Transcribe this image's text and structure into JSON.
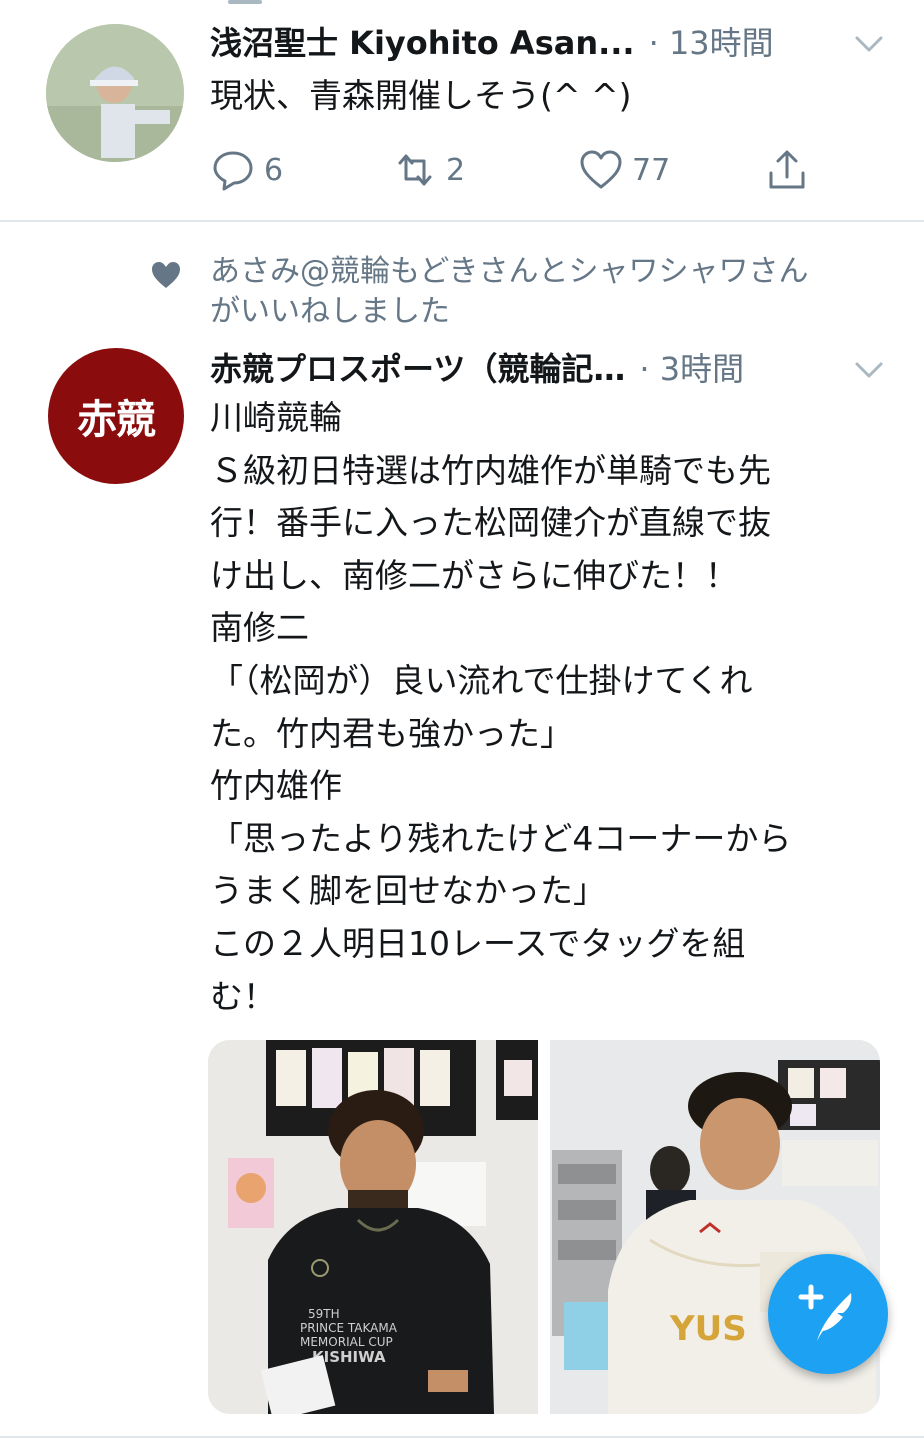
{
  "tweet1": {
    "author": "浅沼聖士 Kiyohito Asan...",
    "time": "· 13時間",
    "text": "現状、青森開催しそう(^ ^)",
    "replies": "6",
    "retweets": "2",
    "likes": "77"
  },
  "social_context": {
    "lines": [
      "あさみ@競輪もどきさんとシャワシャワさん",
      "がいいねしました"
    ]
  },
  "tweet2": {
    "avatar_text": "赤競",
    "author": "赤競プロスポーツ（競輪記…",
    "time": "· 3時間",
    "lines": [
      "川崎競輪",
      "Ｓ級初日特選は竹内雄作が単騎でも先",
      "行！番手に入った松岡健介が直線で抜",
      "け出し、南修二がさらに伸びた！！",
      "南修二",
      "「（松岡が）良い流れで仕掛けてくれ",
      "た。竹内君も強かった」",
      "竹内雄作",
      "「思ったより残れたけど4コーナーから",
      "うまく脚を回せなかった」",
      "この２人明日10レースでタッグを組",
      "む！"
    ],
    "photos": {
      "left": {
        "jersey_text": [
          "59TH",
          "PRINCE TAKAMA",
          "MEMORIAL CUP",
          "KISHIWA"
        ]
      },
      "right": {
        "jersey_text": "YUS"
      }
    }
  },
  "colors": {
    "brand": "#1da1f2",
    "text_primary": "#14171a",
    "text_secondary": "#657786",
    "divider": "#e1e8ed",
    "avatar_red": "#8b0c0c"
  },
  "icons": {
    "reply": "reply-icon",
    "retweet": "retweet-icon",
    "like": "heart-icon",
    "share": "share-icon",
    "caret": "chevron-down-icon",
    "compose": "compose-tweet-icon"
  }
}
